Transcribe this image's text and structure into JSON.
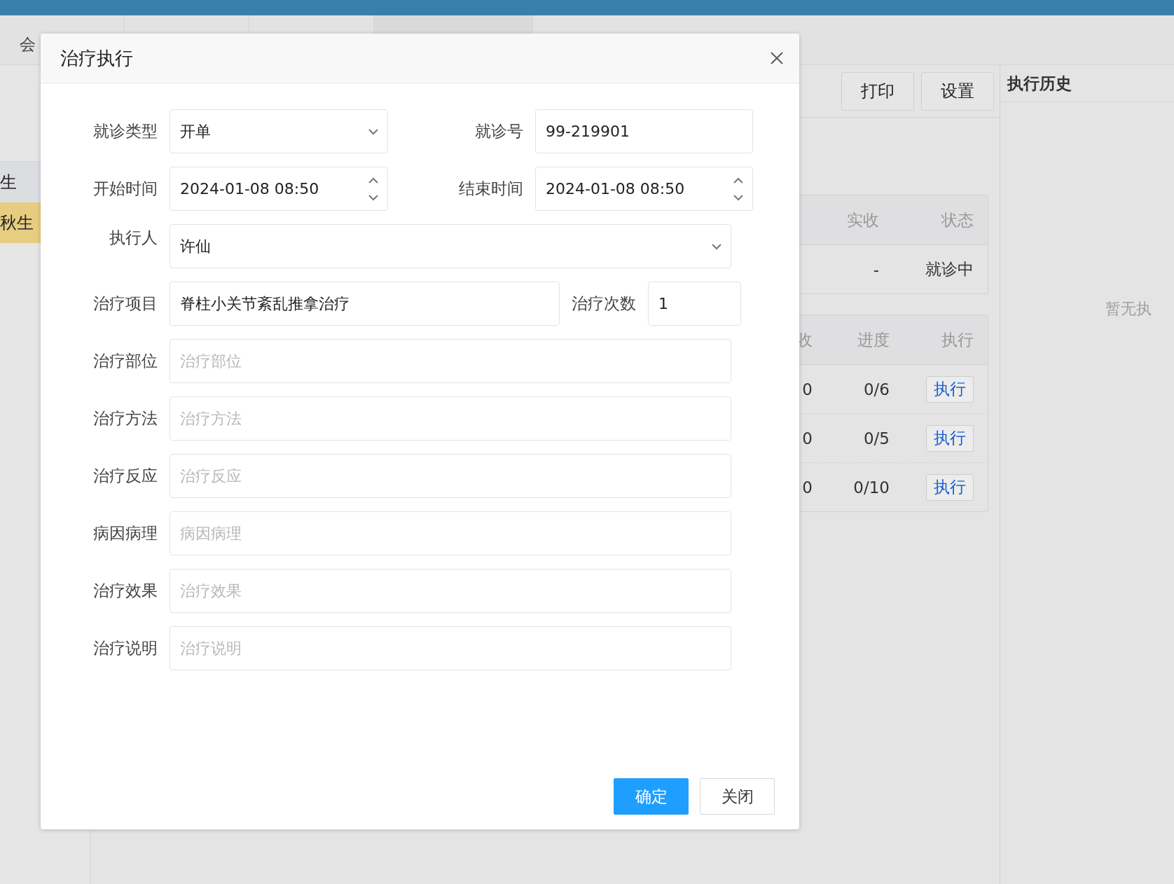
{
  "top_tabs": [
    {
      "label": "会",
      "selected": false
    },
    {
      "selected": false
    },
    {
      "selected": false
    },
    {
      "selected": true
    }
  ],
  "sidebar": {
    "items": [
      {
        "label": "生",
        "selected": false
      },
      {
        "label": "秋生",
        "selected": true
      }
    ]
  },
  "toolbar": {
    "buttons": [
      "打印",
      "设置"
    ]
  },
  "visit_table": {
    "columns": [
      "实收",
      "状态"
    ],
    "rows": [
      [
        "-",
        "就诊中"
      ]
    ]
  },
  "items_table": {
    "columns": [
      "收",
      "进度",
      "执行"
    ],
    "rows": [
      {
        "cells": [
          "0",
          "0/6"
        ],
        "action": "执行"
      },
      {
        "cells": [
          "0",
          "0/5"
        ],
        "action": "执行"
      },
      {
        "cells": [
          "0",
          "0/10"
        ],
        "action": "执行"
      }
    ]
  },
  "history": {
    "title": "执行历史",
    "empty_text": "暂无执"
  },
  "dialog": {
    "title": "治疗执行",
    "rows": [
      {
        "kind": "pair",
        "fields": [
          {
            "label": "就诊类型",
            "kind": "select",
            "value": "开单"
          },
          {
            "label": "就诊号",
            "kind": "text",
            "value": "99-219901"
          }
        ]
      },
      {
        "kind": "pair",
        "fields": [
          {
            "label": "开始时间",
            "kind": "datetime",
            "value": "2024-01-08 08:50"
          },
          {
            "label": "结束时间",
            "kind": "datetime",
            "value": "2024-01-08 08:50"
          }
        ]
      },
      {
        "kind": "single",
        "fields": [
          {
            "label": "执行人",
            "kind": "select",
            "value": "许仙"
          }
        ]
      },
      {
        "kind": "item_count",
        "fields": [
          {
            "label": "治疗项目",
            "kind": "text",
            "value": "脊柱小关节紊乱推拿治疗"
          },
          {
            "label": "治疗次数",
            "kind": "text",
            "value": "1"
          }
        ]
      },
      {
        "kind": "single",
        "fields": [
          {
            "label": "治疗部位",
            "kind": "text",
            "placeholder": "治疗部位"
          }
        ]
      },
      {
        "kind": "single",
        "fields": [
          {
            "label": "治疗方法",
            "kind": "text",
            "placeholder": "治疗方法"
          }
        ]
      },
      {
        "kind": "single",
        "fields": [
          {
            "label": "治疗反应",
            "kind": "text",
            "placeholder": "治疗反应"
          }
        ]
      },
      {
        "kind": "single",
        "fields": [
          {
            "label": "病因病理",
            "kind": "text",
            "placeholder": "病因病理"
          }
        ]
      },
      {
        "kind": "single",
        "fields": [
          {
            "label": "治疗效果",
            "kind": "text",
            "placeholder": "治疗效果"
          }
        ]
      },
      {
        "kind": "single",
        "fields": [
          {
            "label": "治疗说明",
            "kind": "text",
            "placeholder": "治疗说明"
          }
        ]
      }
    ],
    "buttons": [
      {
        "label": "确定",
        "kind": "primary"
      },
      {
        "label": "关闭",
        "kind": "default"
      }
    ]
  }
}
